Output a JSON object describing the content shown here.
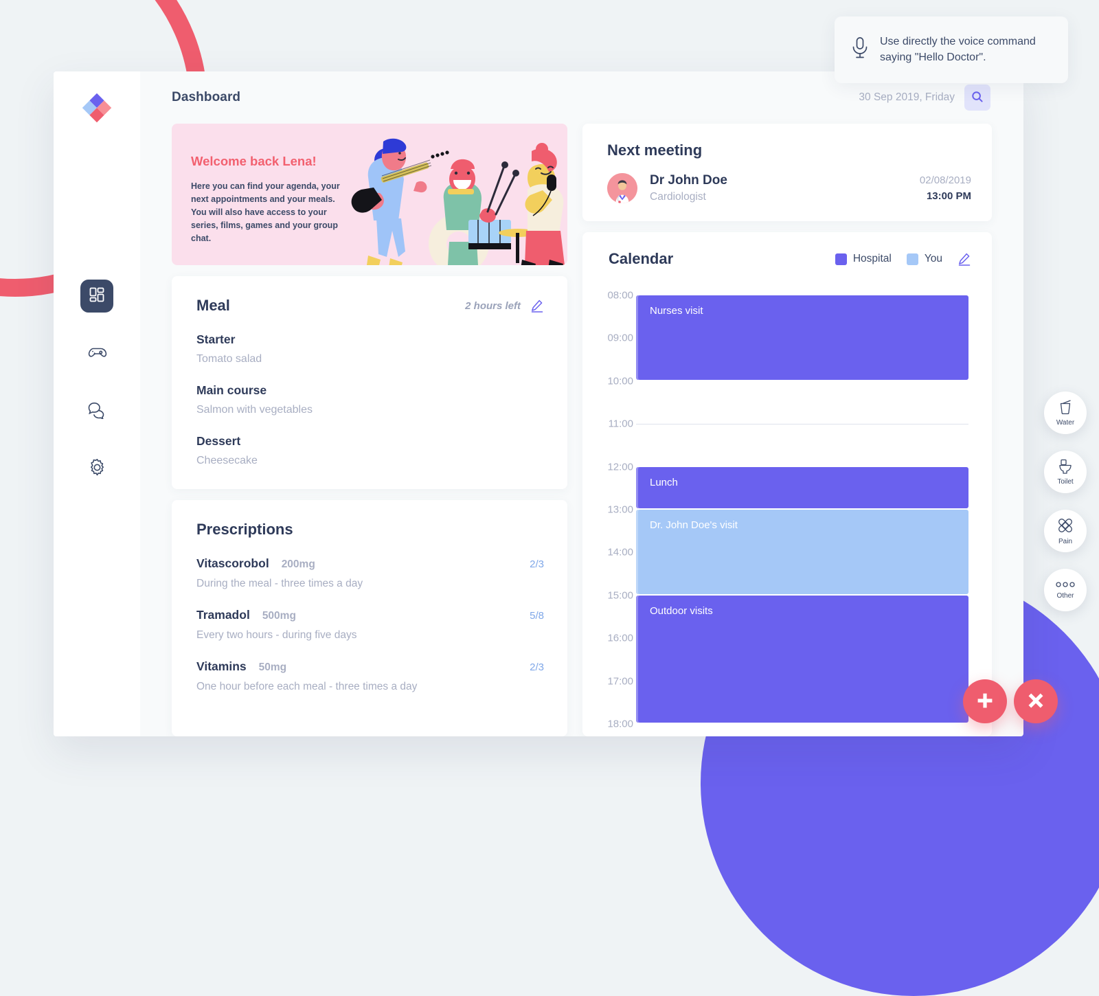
{
  "voice_tip": {
    "icon": "microphone-icon",
    "text": "Use directly the voice command saying \"Hello Doctor\"."
  },
  "sidebar": {
    "logo": "app-logo-diamond",
    "items": [
      {
        "name": "dashboard",
        "icon": "grid-dashboard-icon",
        "active": true
      },
      {
        "name": "games",
        "icon": "gamepad-icon",
        "active": false
      },
      {
        "name": "chat",
        "icon": "chat-bubbles-icon",
        "active": false
      },
      {
        "name": "settings",
        "icon": "gear-icon",
        "active": false
      }
    ]
  },
  "topbar": {
    "title": "Dashboard",
    "date": "30 Sep 2019, Friday",
    "search_icon": "search-icon"
  },
  "welcome": {
    "title": "Welcome back Lena!",
    "body": "Here you can find your agenda, your next appointments and your meals. You will also have access to your series, films, games and your group chat.",
    "illustration": "band-playing-music-illustration"
  },
  "meal": {
    "title": "Meal",
    "time_left": "2 hours left",
    "edit_icon": "pencil-edit-icon",
    "courses": [
      {
        "label": "Starter",
        "value": "Tomato salad"
      },
      {
        "label": "Main course",
        "value": "Salmon with vegetables"
      },
      {
        "label": "Dessert",
        "value": "Cheesecake"
      }
    ]
  },
  "prescriptions": {
    "title": "Prescriptions",
    "items": [
      {
        "name": "Vitascorobol",
        "dose": "200mg",
        "count": "2/3",
        "desc": "During the meal - three times a day"
      },
      {
        "name": "Tramadol",
        "dose": "500mg",
        "count": "5/8",
        "desc": "Every two hours - during five days"
      },
      {
        "name": "Vitamins",
        "dose": "50mg",
        "count": "2/3",
        "desc": "One hour before each meal - three times a day"
      }
    ]
  },
  "next_meeting": {
    "title": "Next meeting",
    "avatar": "doctor-avatar",
    "doctor": "Dr John Doe",
    "specialty": "Cardiologist",
    "date": "02/08/2019",
    "time": "13:00 PM"
  },
  "calendar": {
    "title": "Calendar",
    "edit_icon": "pencil-edit-icon",
    "legend": [
      {
        "label": "Hospital",
        "color": "#6a61ee"
      },
      {
        "label": "You",
        "color": "#a5c8f7"
      }
    ],
    "hours": [
      "08:00",
      "09:00",
      "10:00",
      "11:00",
      "12:00",
      "13:00",
      "14:00",
      "15:00",
      "16:00",
      "17:00",
      "18:00"
    ],
    "current_line_hour": "11:00",
    "events": [
      {
        "label": "Nurses visit",
        "start": "08:00",
        "end": "10:00",
        "color": "#6a61ee"
      },
      {
        "label": "Lunch",
        "start": "12:00",
        "end": "13:00",
        "color": "#6a61ee"
      },
      {
        "label": "Dr. John Doe's visit",
        "start": "13:00",
        "end": "15:00",
        "color": "#a5c8f7"
      },
      {
        "label": "Outdoor visits",
        "start": "15:00",
        "end": "18:00",
        "color": "#6a61ee"
      }
    ]
  },
  "quick_actions": [
    {
      "label": "Water",
      "icon": "water-glass-icon"
    },
    {
      "label": "Toilet",
      "icon": "toilet-icon"
    },
    {
      "label": "Pain",
      "icon": "bandage-cross-icon"
    },
    {
      "label": "Other",
      "icon": "three-dots-icon"
    }
  ],
  "fabs": [
    {
      "name": "add",
      "icon": "plus-icon",
      "color": "#ef5d6e"
    },
    {
      "name": "close",
      "icon": "close-x-icon",
      "color": "#ef5d6e"
    }
  ],
  "theme": {
    "accent_purple": "#6a61ee",
    "accent_red": "#ef5d6e",
    "light_blue": "#a5c8f7",
    "pink_banner": "#fbdfec",
    "page_bg": "#eff3f5"
  }
}
